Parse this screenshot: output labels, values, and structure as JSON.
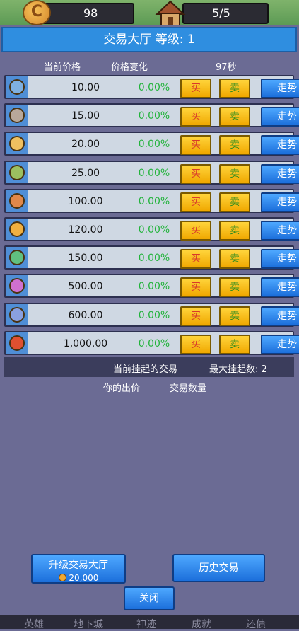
{
  "top": {
    "coins": "98",
    "coin_symbol": "C",
    "heroes": "5/5"
  },
  "header": {
    "title": "交易大厅 等级: 1"
  },
  "columns": {
    "price": "当前价格",
    "change": "价格变化",
    "timer": "97秒"
  },
  "rows": [
    {
      "price": "10.00",
      "change": "0.00%",
      "buy": "买",
      "sell": "卖",
      "trend": "走势",
      "color": "#7fb0e0"
    },
    {
      "price": "15.00",
      "change": "0.00%",
      "buy": "买",
      "sell": "卖",
      "trend": "走势",
      "color": "#b8a89a"
    },
    {
      "price": "20.00",
      "change": "0.00%",
      "buy": "买",
      "sell": "卖",
      "trend": "走势",
      "color": "#f0c060"
    },
    {
      "price": "25.00",
      "change": "0.00%",
      "buy": "买",
      "sell": "卖",
      "trend": "走势",
      "color": "#9cc060"
    },
    {
      "price": "100.00",
      "change": "0.00%",
      "buy": "买",
      "sell": "卖",
      "trend": "走势",
      "color": "#e0884a"
    },
    {
      "price": "120.00",
      "change": "0.00%",
      "buy": "买",
      "sell": "卖",
      "trend": "走势",
      "color": "#f0b040"
    },
    {
      "price": "150.00",
      "change": "0.00%",
      "buy": "买",
      "sell": "卖",
      "trend": "走势",
      "color": "#60c080"
    },
    {
      "price": "500.00",
      "change": "0.00%",
      "buy": "买",
      "sell": "卖",
      "trend": "走势",
      "color": "#d070d0"
    },
    {
      "price": "600.00",
      "change": "0.00%",
      "buy": "买",
      "sell": "卖",
      "trend": "走势",
      "color": "#8aa0e0"
    },
    {
      "price": "1,000.00",
      "change": "0.00%",
      "buy": "买",
      "sell": "卖",
      "trend": "走势",
      "color": "#e05030"
    }
  ],
  "pending": {
    "label": "当前挂起的交易",
    "max": "最大挂起数: 2"
  },
  "orders": {
    "your_bid": "你的出价",
    "quantity": "交易数量"
  },
  "buttons": {
    "upgrade": "升级交易大厅",
    "upgrade_cost": "20,000",
    "history": "历史交易",
    "close": "关闭"
  },
  "nav": [
    "英雄",
    "地下城",
    "神迹",
    "成就",
    "还债"
  ]
}
